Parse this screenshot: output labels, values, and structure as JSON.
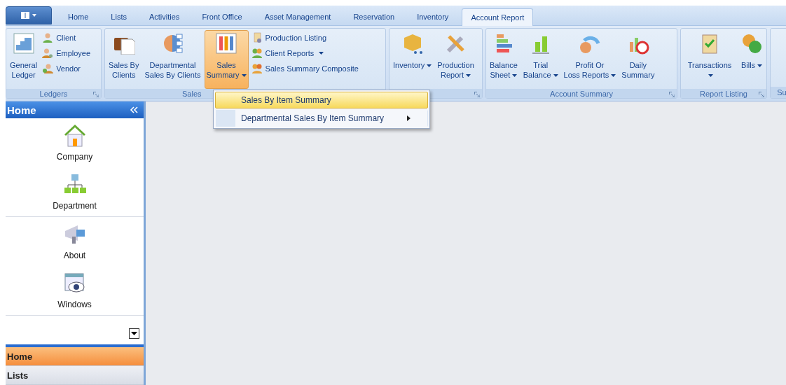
{
  "tabs": [
    {
      "label": "Home",
      "selected": false
    },
    {
      "label": "Lists",
      "selected": false
    },
    {
      "label": "Activities",
      "selected": false
    },
    {
      "label": "Front Office",
      "selected": false
    },
    {
      "label": "Asset Management",
      "selected": false
    },
    {
      "label": "Reservation",
      "selected": false
    },
    {
      "label": "Inventory",
      "selected": false
    },
    {
      "label": "Account Report",
      "selected": true
    }
  ],
  "ribbon": {
    "groups": [
      {
        "label": "Ledgers",
        "launcher": true,
        "items": [
          {
            "kind": "large",
            "label": "General\nLedger",
            "dropdown": false,
            "pressed": false
          },
          {
            "kind": "small",
            "label": "Client",
            "dropdown": false
          },
          {
            "kind": "small",
            "label": "Employee",
            "dropdown": false
          },
          {
            "kind": "small",
            "label": "Vendor",
            "dropdown": false
          }
        ]
      },
      {
        "label": "Sales",
        "launcher": false,
        "items": [
          {
            "kind": "large",
            "label": "Sales By\nClients",
            "dropdown": false,
            "pressed": false
          },
          {
            "kind": "large",
            "label": "Departmental\nSales By Clients",
            "dropdown": false,
            "pressed": false
          },
          {
            "kind": "large",
            "label": "Sales\nSummary",
            "dropdown": true,
            "pressed": true
          },
          {
            "kind": "small",
            "label": "Production Listing",
            "dropdown": false
          },
          {
            "kind": "small",
            "label": "Client Reports",
            "dropdown": true
          },
          {
            "kind": "small",
            "label": "Sales Summary Composite",
            "dropdown": false
          }
        ]
      },
      {
        "launcher": true,
        "items": [
          {
            "kind": "large",
            "label": "Inventory",
            "dropdown": true,
            "pressed": false
          },
          {
            "kind": "large",
            "label": "Production\nReport",
            "dropdown": true,
            "pressed": false
          }
        ]
      },
      {
        "label": "Account Summary",
        "launcher": true,
        "items": [
          {
            "kind": "large",
            "label": "Balance\nSheet",
            "dropdown": true,
            "pressed": false
          },
          {
            "kind": "large",
            "label": "Trial\nBalance",
            "dropdown": true,
            "pressed": false
          },
          {
            "kind": "large",
            "label": "Profit Or\nLoss Reports",
            "dropdown": true,
            "pressed": false
          },
          {
            "kind": "large",
            "label": "Daily\nSummary",
            "dropdown": false,
            "pressed": false
          }
        ]
      },
      {
        "label": "Report Listing",
        "launcher": true,
        "items": [
          {
            "kind": "large",
            "label": "Transactions",
            "dropdown": true,
            "pressed": false
          },
          {
            "kind": "large",
            "label": "Bills",
            "dropdown": true,
            "pressed": false
          }
        ]
      },
      {
        "label": "Su",
        "launcher": false
      }
    ]
  },
  "menu": {
    "items": [
      {
        "label": "Sales By Item Summary",
        "highlighted": true,
        "submenu": false
      },
      {
        "label": "Departmental Sales By Item Summary",
        "highlighted": false,
        "submenu": true
      }
    ]
  },
  "sidebar": {
    "title": "Home",
    "items": [
      {
        "label": "Company"
      },
      {
        "label": "Department"
      },
      {
        "label": "About"
      },
      {
        "label": "Windows"
      }
    ],
    "nav": [
      {
        "label": "Home",
        "selected": true
      },
      {
        "label": "Lists",
        "selected": false
      }
    ]
  }
}
